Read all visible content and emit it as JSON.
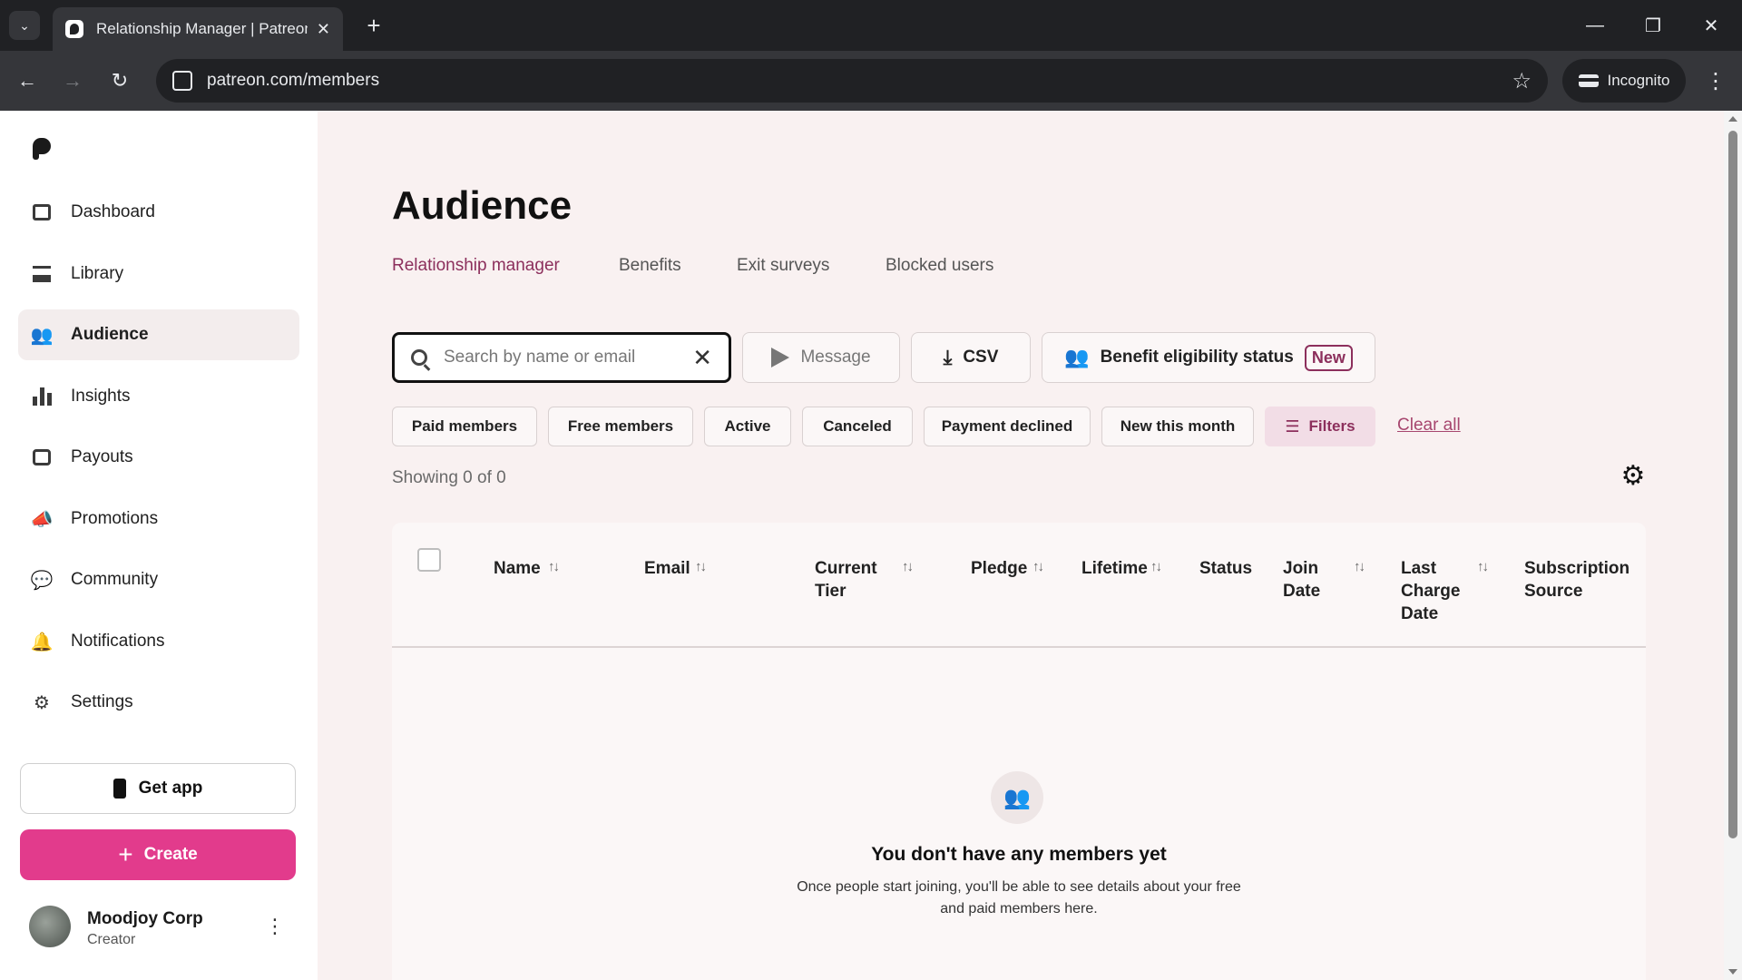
{
  "browser": {
    "tab_title": "Relationship Manager | Patreon",
    "url": "patreon.com/members",
    "incognito_label": "Incognito"
  },
  "sidebar": {
    "items": [
      {
        "label": "Dashboard",
        "icon": "dashboard-icon"
      },
      {
        "label": "Library",
        "icon": "library-icon"
      },
      {
        "label": "Audience",
        "icon": "audience-icon",
        "active": true
      },
      {
        "label": "Insights",
        "icon": "insights-icon"
      },
      {
        "label": "Payouts",
        "icon": "payouts-icon"
      },
      {
        "label": "Promotions",
        "icon": "megaphone-icon"
      },
      {
        "label": "Community",
        "icon": "chat-bubbles-icon"
      },
      {
        "label": "Notifications",
        "icon": "bell-icon"
      },
      {
        "label": "Settings",
        "icon": "gear-icon"
      }
    ],
    "get_app_label": "Get app",
    "create_label": "Create",
    "user": {
      "name": "Moodjoy Corp",
      "role": "Creator"
    }
  },
  "main": {
    "title": "Audience",
    "tabs": [
      {
        "label": "Relationship manager",
        "active": true
      },
      {
        "label": "Benefits"
      },
      {
        "label": "Exit surveys"
      },
      {
        "label": "Blocked users"
      }
    ],
    "search": {
      "placeholder": "Search by name or email",
      "value": ""
    },
    "toolbar": {
      "message_label": "Message",
      "csv_label": "CSV",
      "benefit_label": "Benefit eligibility status",
      "new_badge": "New"
    },
    "filters": [
      "Paid members",
      "Free members",
      "Active",
      "Canceled",
      "Payment declined",
      "New this month"
    ],
    "filters_button": "Filters",
    "clear_all": "Clear all",
    "showing": "Showing 0 of 0",
    "columns": {
      "name": "Name",
      "email": "Email",
      "current_tier": "Current Tier",
      "pledge": "Pledge",
      "lifetime": "Lifetime",
      "status": "Status",
      "join_date": "Join Date",
      "last_charge_date": "Last Charge Date",
      "subscription_source": "Subscription Source"
    },
    "empty": {
      "title": "You don't have any members yet",
      "desc_line1": "Once people start joining, you'll be able to see details about your free",
      "desc_line2": "and paid members here."
    }
  },
  "colors": {
    "accent": "#8c2f5c",
    "create_button": "#e23b8c",
    "page_bg": "#f9f1f1"
  }
}
